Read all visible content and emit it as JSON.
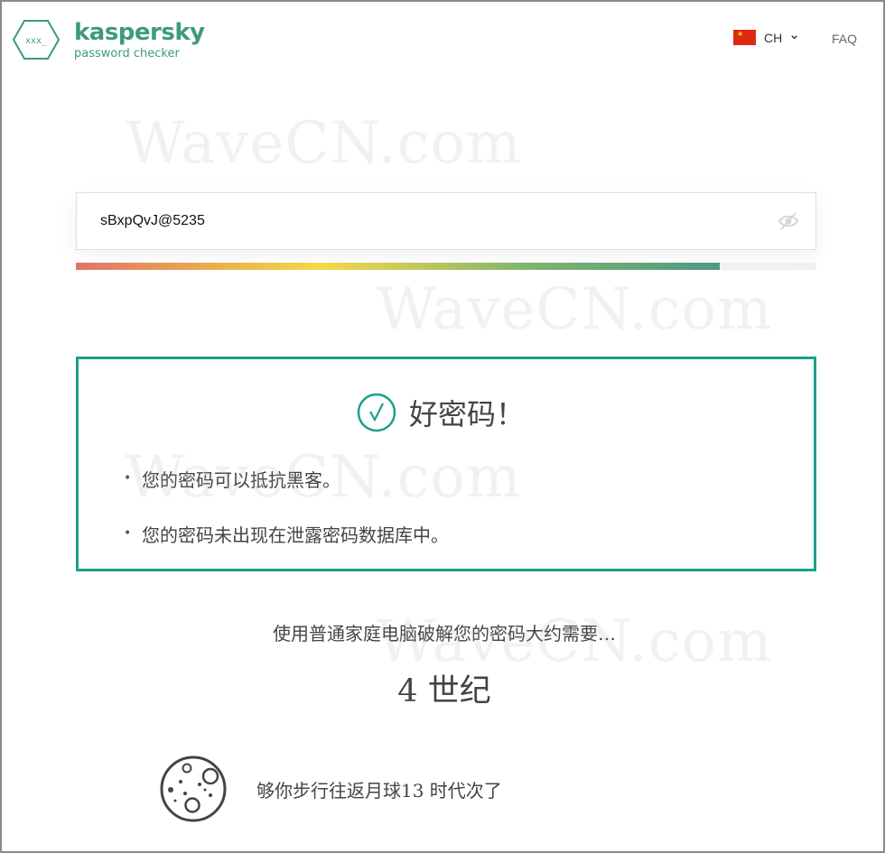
{
  "header": {
    "brand_name": "kaspersky",
    "brand_sub": "password checker",
    "logo_mark": "xxx_",
    "language_code": "CH",
    "flag_icon": "china-flag-icon",
    "faq_label": "FAQ"
  },
  "password": {
    "value": "sBxpQvJ@5235",
    "strength_percent": 87,
    "toggle_icon": "eye-slash-icon"
  },
  "result": {
    "verdict": "好密码！",
    "bullets": [
      "您的密码可以抵抗黑客。",
      "您的密码未出现在泄露密码数据库中。"
    ]
  },
  "crack": {
    "label": "使用普通家庭电脑破解您的密码大约需要…",
    "time": "4 世纪"
  },
  "comparison": {
    "icon": "moon-icon",
    "text": "够你步行往返月球13 时代次了"
  },
  "watermark": "WaveCN.com",
  "colors": {
    "brand": "#3e9a7f",
    "result_border": "#1d9f8a",
    "flag": "#de2910"
  }
}
